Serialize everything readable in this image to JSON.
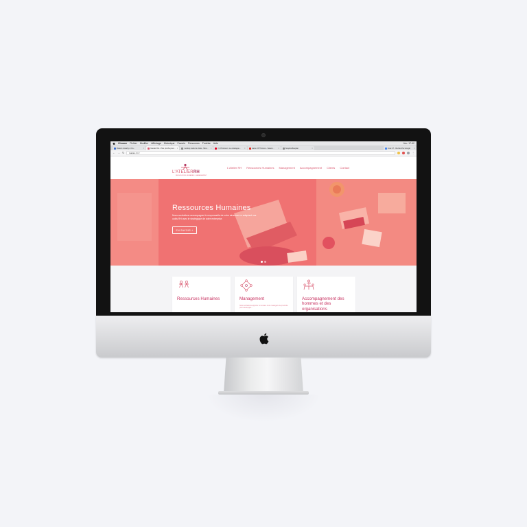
{
  "menubar": {
    "app_name": "Chrome",
    "items": [
      "Fichier",
      "Modifier",
      "Affichage",
      "Historique",
      "Favoris",
      "Personnes",
      "Fenêtre",
      "Aide"
    ],
    "clock": "Jeu. 17:42"
  },
  "tabs": [
    {
      "label": "Rosie's Jewelry & Co...",
      "color": "#3b6fd1",
      "active": false
    },
    {
      "label": "l'atelier RH - Plus proche pour...",
      "color": "#d9566e",
      "active": true
    },
    {
      "label": "mockup carte de visite - Moo...",
      "color": "#888888",
      "active": false
    },
    {
      "label": "(1) Pinterest • Le catalogue...",
      "color": "#e60023",
      "active": false
    },
    {
      "label": "Game Of Thrones - Saison...",
      "color": "#e62117",
      "active": false
    },
    {
      "label": "Snapdocflauplan",
      "color": "#888888",
      "active": false
    },
    {
      "label": "Imac 27 - Recherche Google",
      "color": "#4285f4",
      "active": false
    }
  ],
  "address_bar": {
    "url": "latelier-rh.fr"
  },
  "site": {
    "logo_text": "L'ATELIER",
    "logo_text_rh": "RH",
    "logo_tagline": "RESSOURCES HUMAINES • MANAGEMENT",
    "nav": [
      "L'Atelier RH",
      "Ressources Humaines",
      "Management",
      "Accompagnement",
      "Clients",
      "Contact"
    ]
  },
  "hero": {
    "title": "Ressources Humaines",
    "text": "Nous souhaitons accompagner le responsable de votre structure en adaptant nos outils RH avec le stratégique de votre entreprise.",
    "button": "EN SAVOIR +",
    "slides_total": 2,
    "slide_active": 1
  },
  "cards": [
    {
      "title": "Ressources Humaines",
      "text": ""
    },
    {
      "title": "Management",
      "text": "Nous souhaitons apporter un soutien à vos managers de proximité pour développer..."
    },
    {
      "title": "Accompagnement des hommes et des organisations",
      "text": ""
    }
  ],
  "colors": {
    "brand_pink": "#d9566e",
    "brand_deep": "#c83462",
    "hero_overlay": "#f07272"
  }
}
